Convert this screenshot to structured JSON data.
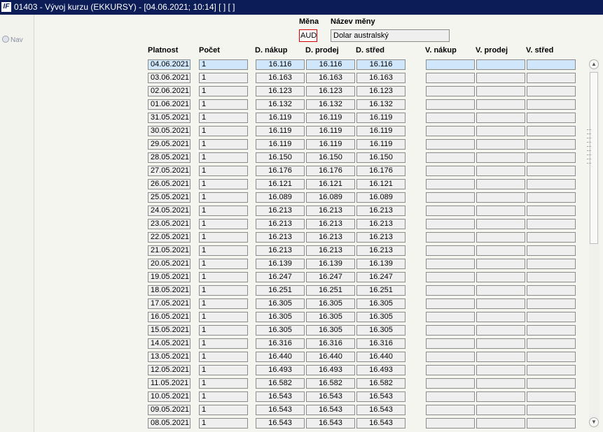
{
  "window": {
    "title": "01403 - Vývoj kurzu (EKKURSY) - [04.06.2021; 10:14] [ ] [ ]",
    "logo": "IF"
  },
  "nav": {
    "label": "Nav"
  },
  "currency": {
    "code_label": "Měna",
    "code": "AUD",
    "name_label": "Název měny",
    "name": "Dolar australský"
  },
  "columns": {
    "platnost": "Platnost",
    "pocet": "Počet",
    "d_nakup": "D. nákup",
    "d_prodej": "D. prodej",
    "d_stred": "D. střed",
    "v_nakup": "V. nákup",
    "v_prodej": "V. prodej",
    "v_stred": "V. střed"
  },
  "rows": [
    {
      "date": "04.06.2021",
      "count": "1",
      "buy": "16.116",
      "sell": "16.116",
      "mid": "16.116"
    },
    {
      "date": "03.06.2021",
      "count": "1",
      "buy": "16.163",
      "sell": "16.163",
      "mid": "16.163"
    },
    {
      "date": "02.06.2021",
      "count": "1",
      "buy": "16.123",
      "sell": "16.123",
      "mid": "16.123"
    },
    {
      "date": "01.06.2021",
      "count": "1",
      "buy": "16.132",
      "sell": "16.132",
      "mid": "16.132"
    },
    {
      "date": "31.05.2021",
      "count": "1",
      "buy": "16.119",
      "sell": "16.119",
      "mid": "16.119"
    },
    {
      "date": "30.05.2021",
      "count": "1",
      "buy": "16.119",
      "sell": "16.119",
      "mid": "16.119"
    },
    {
      "date": "29.05.2021",
      "count": "1",
      "buy": "16.119",
      "sell": "16.119",
      "mid": "16.119"
    },
    {
      "date": "28.05.2021",
      "count": "1",
      "buy": "16.150",
      "sell": "16.150",
      "mid": "16.150"
    },
    {
      "date": "27.05.2021",
      "count": "1",
      "buy": "16.176",
      "sell": "16.176",
      "mid": "16.176"
    },
    {
      "date": "26.05.2021",
      "count": "1",
      "buy": "16.121",
      "sell": "16.121",
      "mid": "16.121"
    },
    {
      "date": "25.05.2021",
      "count": "1",
      "buy": "16.089",
      "sell": "16.089",
      "mid": "16.089"
    },
    {
      "date": "24.05.2021",
      "count": "1",
      "buy": "16.213",
      "sell": "16.213",
      "mid": "16.213"
    },
    {
      "date": "23.05.2021",
      "count": "1",
      "buy": "16.213",
      "sell": "16.213",
      "mid": "16.213"
    },
    {
      "date": "22.05.2021",
      "count": "1",
      "buy": "16.213",
      "sell": "16.213",
      "mid": "16.213"
    },
    {
      "date": "21.05.2021",
      "count": "1",
      "buy": "16.213",
      "sell": "16.213",
      "mid": "16.213"
    },
    {
      "date": "20.05.2021",
      "count": "1",
      "buy": "16.139",
      "sell": "16.139",
      "mid": "16.139"
    },
    {
      "date": "19.05.2021",
      "count": "1",
      "buy": "16.247",
      "sell": "16.247",
      "mid": "16.247"
    },
    {
      "date": "18.05.2021",
      "count": "1",
      "buy": "16.251",
      "sell": "16.251",
      "mid": "16.251"
    },
    {
      "date": "17.05.2021",
      "count": "1",
      "buy": "16.305",
      "sell": "16.305",
      "mid": "16.305"
    },
    {
      "date": "16.05.2021",
      "count": "1",
      "buy": "16.305",
      "sell": "16.305",
      "mid": "16.305"
    },
    {
      "date": "15.05.2021",
      "count": "1",
      "buy": "16.305",
      "sell": "16.305",
      "mid": "16.305"
    },
    {
      "date": "14.05.2021",
      "count": "1",
      "buy": "16.316",
      "sell": "16.316",
      "mid": "16.316"
    },
    {
      "date": "13.05.2021",
      "count": "1",
      "buy": "16.440",
      "sell": "16.440",
      "mid": "16.440"
    },
    {
      "date": "12.05.2021",
      "count": "1",
      "buy": "16.493",
      "sell": "16.493",
      "mid": "16.493"
    },
    {
      "date": "11.05.2021",
      "count": "1",
      "buy": "16.582",
      "sell": "16.582",
      "mid": "16.582"
    },
    {
      "date": "10.05.2021",
      "count": "1",
      "buy": "16.543",
      "sell": "16.543",
      "mid": "16.543"
    },
    {
      "date": "09.05.2021",
      "count": "1",
      "buy": "16.543",
      "sell": "16.543",
      "mid": "16.543"
    },
    {
      "date": "08.05.2021",
      "count": "1",
      "buy": "16.543",
      "sell": "16.543",
      "mid": "16.543"
    }
  ],
  "selected_row_index": 0
}
